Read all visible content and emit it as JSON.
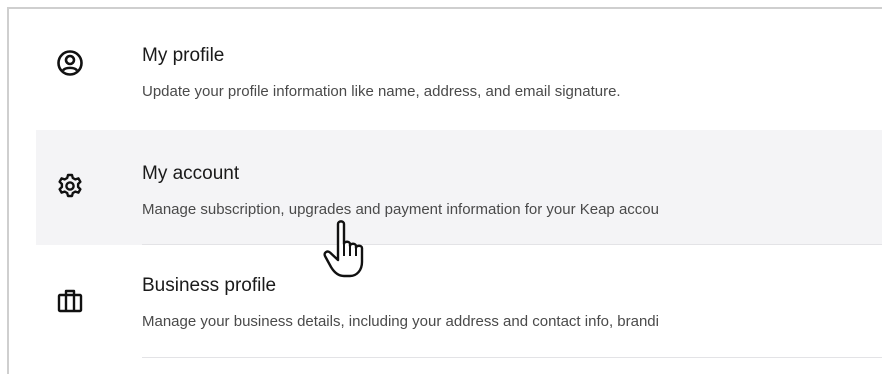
{
  "settings_menu": {
    "items": [
      {
        "icon": "user-circle-icon",
        "title": "My profile",
        "description": "Update your profile information like name, address, and email signature."
      },
      {
        "icon": "gear-icon",
        "title": "My account",
        "description": "Manage subscription, upgrades and payment information for your Keap accou"
      },
      {
        "icon": "briefcase-icon",
        "title": "Business profile",
        "description": "Manage your business details, including your address and contact info, brandi"
      }
    ],
    "hovered_item": "My account"
  },
  "colors": {
    "hover_background": "#f4f4f6",
    "text_primary": "#1a1a1a",
    "text_secondary": "#4a4a4a",
    "separator": "#e3e3e6",
    "frame_border": "#cfcfcf"
  },
  "cursor": "hand-pointer-icon"
}
